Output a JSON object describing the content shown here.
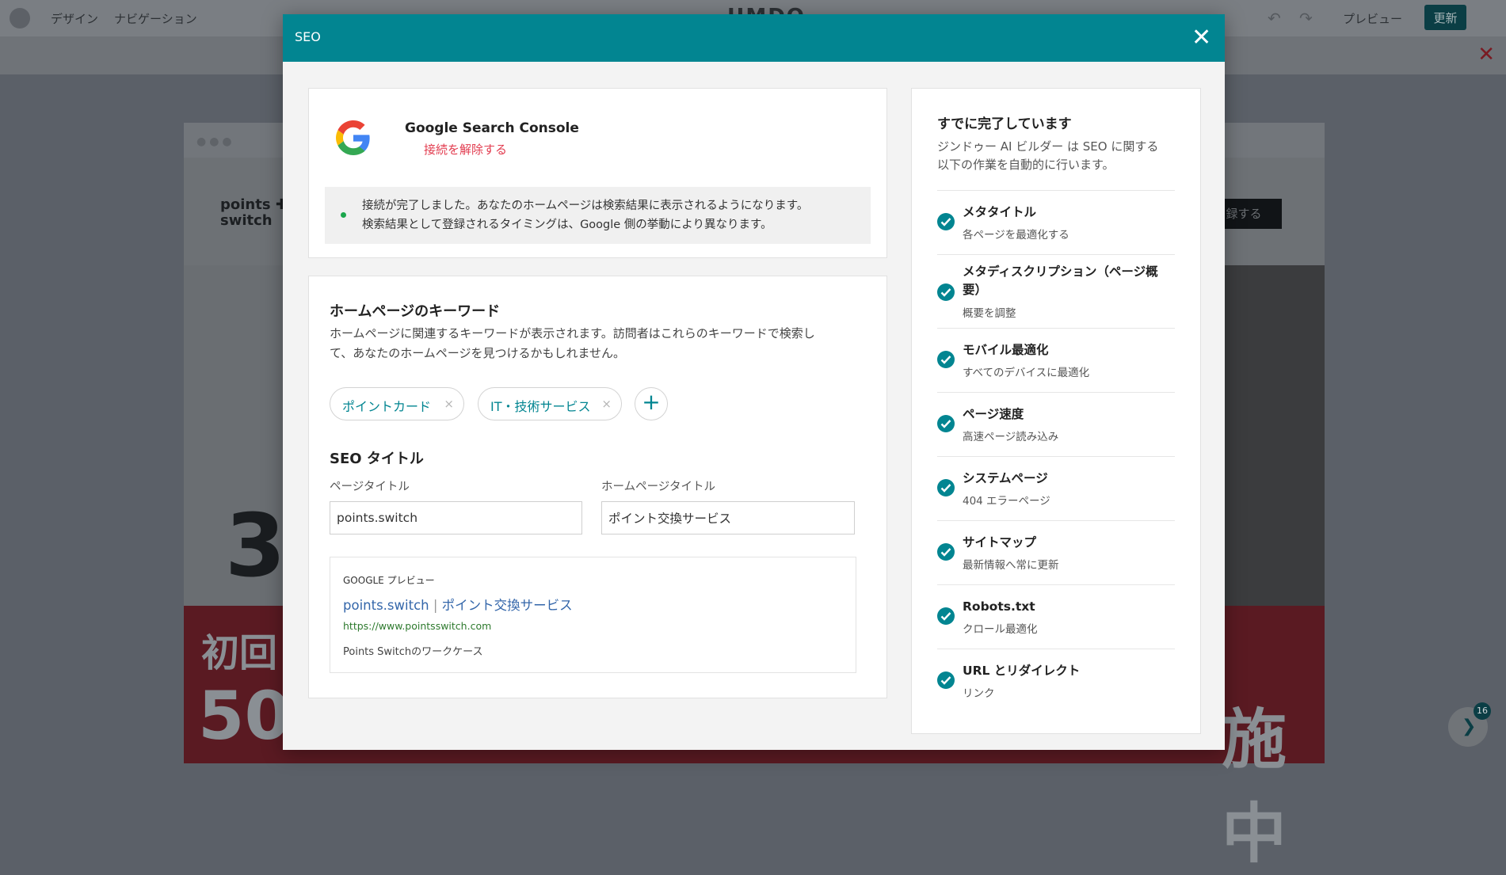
{
  "editor": {
    "menu_design": "デザイン",
    "menu_navigation": "ナビゲーション",
    "logo": "JIMDO",
    "undo_icon": "↶",
    "redo_icon": "↷",
    "preview": "プレビュー",
    "update": "更新",
    "close_icon": "✕",
    "site_brand": "points ✚\nswitch",
    "site_button": "録する",
    "hero_number": "3",
    "banner_line1": "初回",
    "banner_line2": "50",
    "banner_right": "施中",
    "fab_arrow": "❯",
    "fab_count": "16"
  },
  "modal": {
    "title": "SEO",
    "close_icon": "✕"
  },
  "gsc": {
    "title": "Google Search Console",
    "disconnect": "接続を解除する",
    "status_line1": "接続が完了しました。あなたのホームページは検索結果に表示されるようになります。",
    "status_line2": "検索結果として登録されるタイミングは、Google 側の挙動により異なります。",
    "status_color": "#1ba64c"
  },
  "keywords": {
    "title": "ホームページのキーワード",
    "desc_line1": "ホームページに関連するキーワードが表示されます。訪問者はこれらのキーワードで検索し",
    "desc_line2": "て、あなたのホームページを見つけるかもしれません。",
    "chips": [
      {
        "label": "ポイントカード",
        "remove": "×"
      },
      {
        "label": "IT・技術サービス",
        "remove": "×"
      }
    ],
    "add_icon": "+"
  },
  "seo_title": {
    "title": "SEO タイトル",
    "page_title_label": "ページタイトル",
    "page_title_value": "points.switch",
    "home_title_label": "ホームページタイトル",
    "home_title_value": "ポイント交換サービス"
  },
  "google_preview": {
    "heading": "GOOGLE プレビュー",
    "page_title": "points.switch",
    "separator": "|",
    "site_title": "ポイント交換サービス",
    "url": "https://www.pointsswitch.com",
    "description": "Points Switchのワークケース"
  },
  "done": {
    "title": "すでに完了しています",
    "desc_line1": "ジンドゥー AI ビルダー は SEO に関する",
    "desc_line2": "以下の作業を自動的に行います。",
    "items": [
      {
        "name": "メタタイトル",
        "sub": "各ページを最適化する"
      },
      {
        "name": "メタディスクリプション（ページ概要）",
        "sub": "概要を調整"
      },
      {
        "name": "モバイル最適化",
        "sub": "すべてのデバイスに最適化"
      },
      {
        "name": "ページ速度",
        "sub": "高速ページ読み込み"
      },
      {
        "name": "システムページ",
        "sub": "404 エラーページ"
      },
      {
        "name": "サイトマップ",
        "sub": "最新情報へ常に更新"
      },
      {
        "name": "Robots.txt",
        "sub": "クロール最適化"
      },
      {
        "name": "URL とリダイレクト",
        "sub": "リンク"
      }
    ],
    "accent_color": "#028591"
  }
}
